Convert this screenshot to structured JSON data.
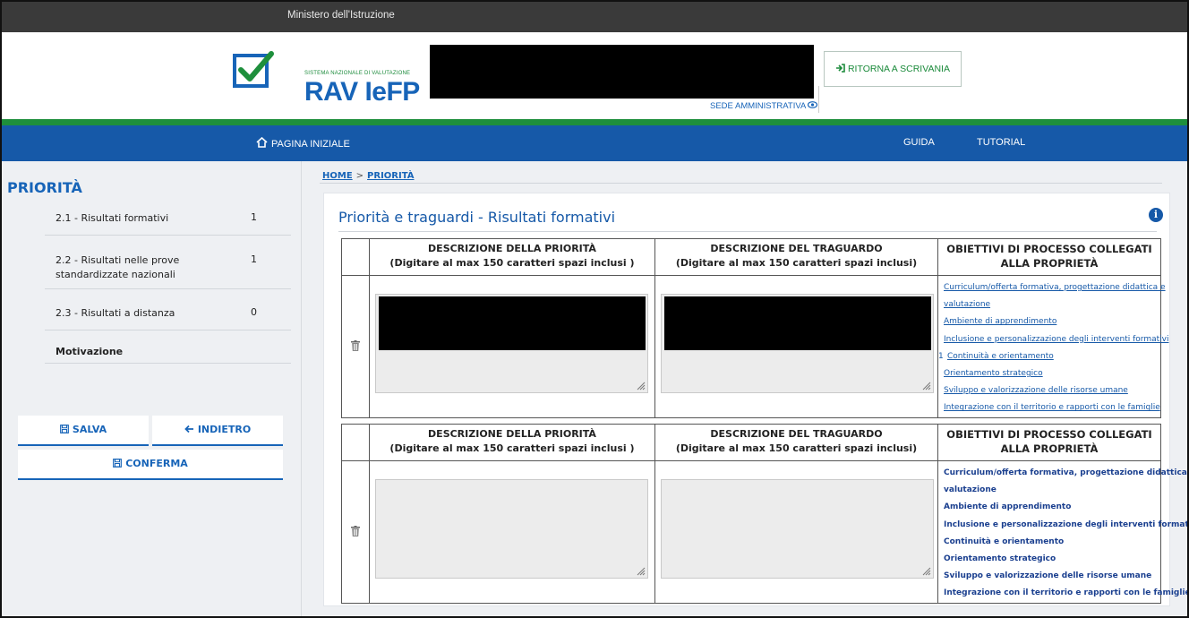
{
  "topbar": {
    "ministry": "Ministero dell'Istruzione"
  },
  "header": {
    "logo_subtitle": "SISTEMA NAZIONALE DI VALUTAZIONE",
    "logo_title": "RAV IeFP",
    "sede_link": "SEDE AMMINISTRATIVA",
    "ritorna_label": "RITORNA A SCRIVANIA"
  },
  "nav": {
    "home": "PAGINA INIZIALE",
    "guida": "GUIDA",
    "tutorial": "TUTORIAL"
  },
  "sidebar": {
    "title": "PRIORITÀ",
    "items": [
      {
        "label": "2.1 - Risultati formativi",
        "count": "1"
      },
      {
        "label": "2.2 - Risultati nelle prove standardizzate nazionali",
        "count": "1"
      },
      {
        "label": "2.3 - Risultati a distanza",
        "count": "0"
      },
      {
        "label": "Motivazione",
        "count": ""
      }
    ],
    "salva_label": "SALVA",
    "indietro_label": "INDIETRO",
    "conferma_label": "CONFERMA"
  },
  "breadcrumb": {
    "home": "HOME",
    "sep": ">",
    "current": "PRIORITÀ"
  },
  "card": {
    "title": "Priorità e traguardi - Risultati formativi"
  },
  "table": {
    "col_priority": "DESCRIZIONE DELLA PRIORITÀ",
    "col_priority_sub": "(Digitare al max 150 caratteri spazi inclusi )",
    "col_goal": "DESCRIZIONE DEL TRAGUARDO",
    "col_goal_sub": "(Digitare al max 150 caratteri spazi inclusi)",
    "col_objectives": "OBIETTIVI DI PROCESSO COLLEGATI ALLA PROPRIETÀ",
    "objectives": [
      "Curriculum/offerta formativa, progettazione didattica e",
      "valutazione",
      "Ambiente di apprendimento",
      "Inclusione e personalizzazione degli interventi formativi",
      "Continuità e orientamento",
      "Orientamento strategico",
      "Sviluppo e valorizzazione delle risorse umane",
      "Integrazione con il territorio e rapporti con le famiglie"
    ],
    "selected_marker": "1"
  },
  "colors": {
    "brand_blue": "#1659a8",
    "brand_green": "#1e8f3c",
    "topbar": "#3a3a3a"
  },
  "icons": [
    "check-logo-icon",
    "login-arrow-icon",
    "eye-icon",
    "home-icon",
    "save-icon",
    "arrow-left-icon",
    "info-icon",
    "trash-icon",
    "resize-grip-icon"
  ]
}
